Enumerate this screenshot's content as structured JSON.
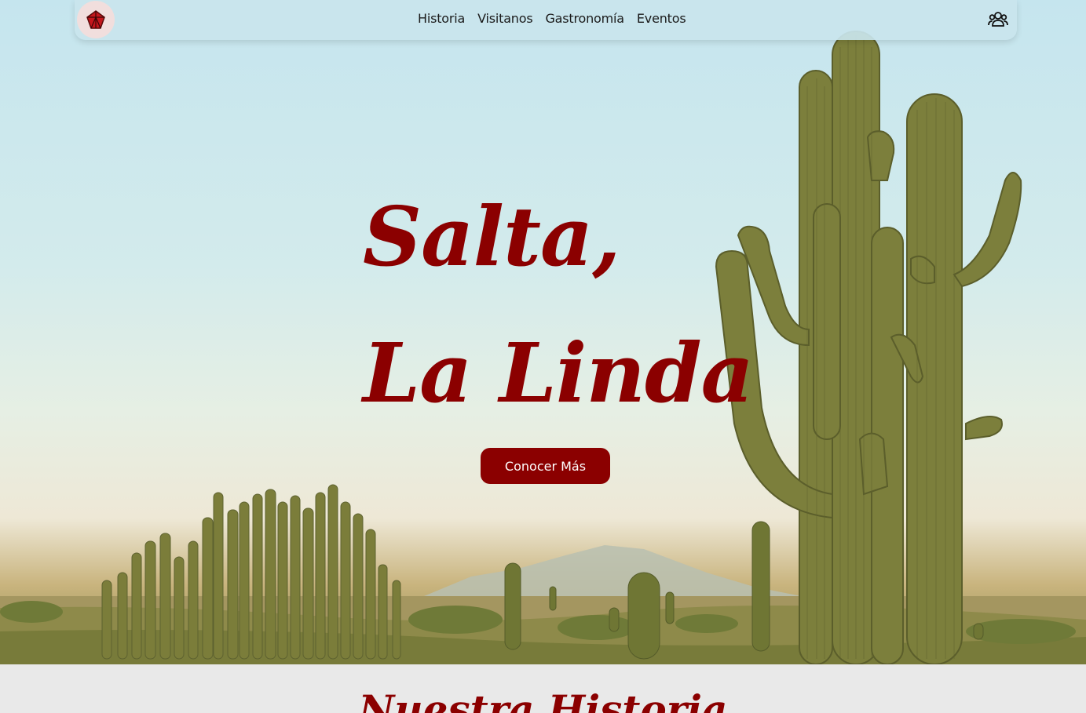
{
  "nav": {
    "logo_icon": "red-gem-logo-icon",
    "links": [
      "Historia",
      "Visitanos",
      "Gastronomía",
      "Eventos"
    ],
    "user_icon": "users-group-icon"
  },
  "hero": {
    "title_line1": "Salta,",
    "title_line2": "La Linda",
    "cta_label": "Conocer Más",
    "background_image": "desert-cactus-landscape"
  },
  "section": {
    "title": "Nuestra Historia"
  },
  "colors": {
    "accent": "#8b0000",
    "nav_bg": "#c9e5ed",
    "section_bg": "#e9e9e9"
  }
}
